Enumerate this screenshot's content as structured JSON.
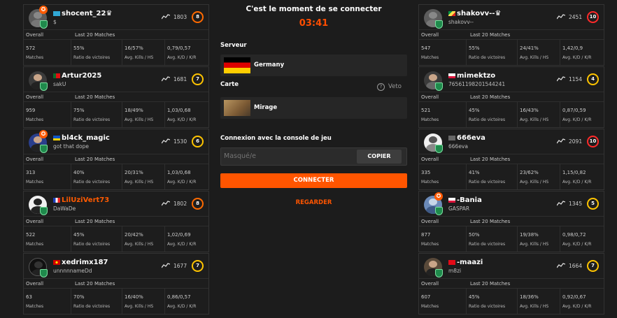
{
  "center": {
    "title": "C'est le moment de se connecter",
    "timer": "03:41",
    "server_label": "Serveur",
    "server_value": "Germany",
    "map_label": "Carte",
    "map_value": "Mirage",
    "veto_label": "Veto",
    "console_label": "Connexion avec la console de jeu",
    "console_placeholder": "Masqué/e",
    "copy_label": "COPIER",
    "connect_label": "CONNECTER",
    "watch_label": "REGARDER"
  },
  "labels": {
    "overall": "Overall",
    "last20": "Last 20 Matches",
    "matches": "Matches",
    "winratio": "Ratio de victoires",
    "kills_hs": "Avg. Kills / HS",
    "kd_kr": "Avg. K/D / K/R"
  },
  "team_left": [
    {
      "name": "shocent_22♛",
      "sub": "$",
      "elo": "1803",
      "level": "8",
      "matches": "572",
      "winrate": "55%",
      "kills_hs": "16/57%",
      "kd_kr": "0,79/0,57"
    },
    {
      "name": "Artur2025",
      "sub": "sakU",
      "elo": "1681",
      "level": "7",
      "matches": "959",
      "winrate": "75%",
      "kills_hs": "18/49%",
      "kd_kr": "1,03/0,68"
    },
    {
      "name": "bl4ck_magic",
      "sub": "got that dope",
      "elo": "1530",
      "level": "6",
      "matches": "313",
      "winrate": "40%",
      "kills_hs": "20/31%",
      "kd_kr": "1,03/0,68"
    },
    {
      "name": "LilUziVert73",
      "sub": "DaWaDe",
      "elo": "1802",
      "level": "8",
      "matches": "522",
      "winrate": "45%",
      "kills_hs": "20/42%",
      "kd_kr": "1,02/0,69"
    },
    {
      "name": "xedrimx187",
      "sub": "unnnnnameDd",
      "elo": "1677",
      "level": "7",
      "matches": "63",
      "winrate": "70%",
      "kills_hs": "16/40%",
      "kd_kr": "0,86/0,57"
    }
  ],
  "team_right": [
    {
      "name": "shakovv--♛",
      "sub": "shakovv--",
      "elo": "2451",
      "level": "10",
      "matches": "547",
      "winrate": "55%",
      "kills_hs": "24/41%",
      "kd_kr": "1,42/0,9"
    },
    {
      "name": "mimektzo",
      "sub": "76561198201544241",
      "elo": "1154",
      "level": "4",
      "matches": "521",
      "winrate": "45%",
      "kills_hs": "16/43%",
      "kd_kr": "0,87/0,59"
    },
    {
      "name": "666eva",
      "sub": "666eva",
      "elo": "2091",
      "level": "10",
      "matches": "335",
      "winrate": "41%",
      "kills_hs": "23/62%",
      "kd_kr": "1,15/0,82"
    },
    {
      "name": "-Bania",
      "sub": "GASPAR",
      "elo": "1345",
      "level": "5",
      "matches": "877",
      "winrate": "50%",
      "kills_hs": "19/38%",
      "kd_kr": "0,98/0,72"
    },
    {
      "name": "-maazi",
      "sub": "m8zi",
      "elo": "1664",
      "level": "7",
      "matches": "607",
      "winrate": "45%",
      "kills_hs": "18/36%",
      "kd_kr": "0,92/0,67"
    }
  ]
}
